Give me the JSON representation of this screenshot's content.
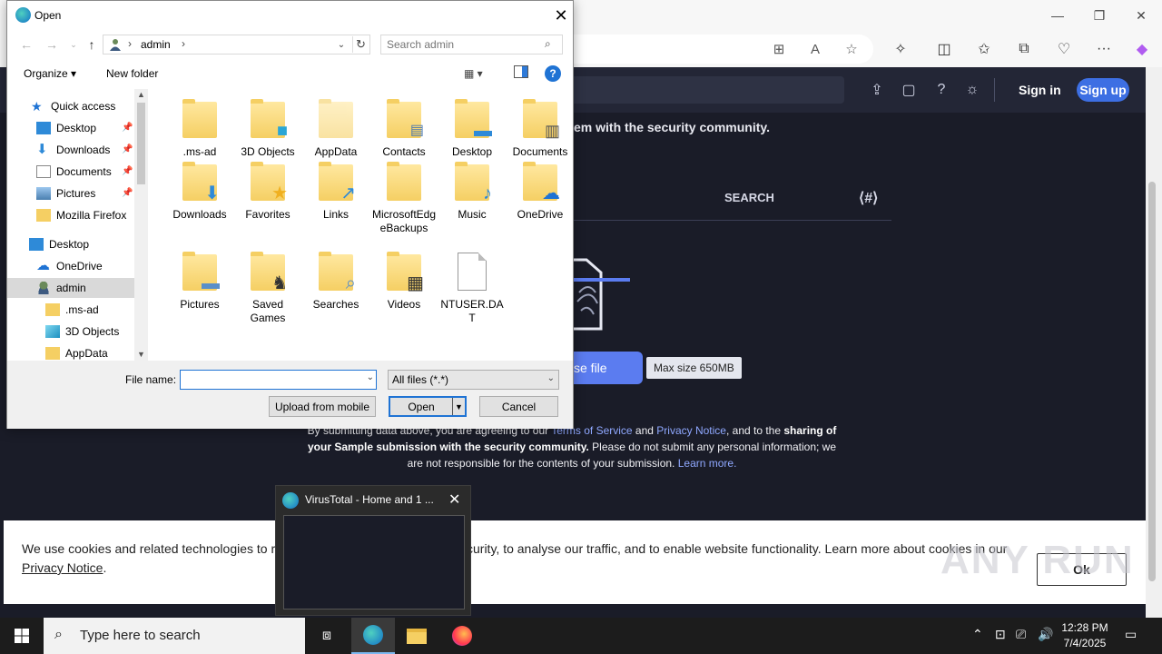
{
  "dialog": {
    "title": "Open",
    "path_label": "admin",
    "search_placeholder": "Search admin",
    "organize_label": "Organize ▾",
    "new_folder_label": "New folder",
    "help_label": "?",
    "file_name_label": "File name:",
    "file_name_value": "",
    "file_type_value": "All files (*.*)",
    "upload_mobile_label": "Upload from mobile",
    "open_label": "Open",
    "cancel_label": "Cancel"
  },
  "nav_pane": {
    "items": [
      {
        "label": "Quick access",
        "icon": "star-icon"
      },
      {
        "label": "Desktop",
        "icon": "desktop-icon",
        "pinned": true
      },
      {
        "label": "Downloads",
        "icon": "download-icon",
        "pinned": true
      },
      {
        "label": "Documents",
        "icon": "document-icon",
        "pinned": true
      },
      {
        "label": "Pictures",
        "icon": "picture-icon",
        "pinned": true
      },
      {
        "label": "Mozilla Firefox",
        "icon": "folder-icon"
      },
      {
        "label": "Desktop",
        "icon": "desktop-icon"
      },
      {
        "label": "OneDrive",
        "icon": "cloud-icon"
      },
      {
        "label": "admin",
        "icon": "user-icon",
        "selected": true
      },
      {
        "label": ".ms-ad",
        "icon": "folder-icon"
      },
      {
        "label": "3D Objects",
        "icon": "cube-icon"
      },
      {
        "label": "AppData",
        "icon": "folder-icon"
      }
    ]
  },
  "files": [
    {
      "label": ".ms-ad",
      "icon": "folder-icon"
    },
    {
      "label": "3D Objects",
      "icon": "cube-folder-icon"
    },
    {
      "label": "AppData",
      "icon": "folder-icon"
    },
    {
      "label": "Contacts",
      "icon": "contacts-folder-icon"
    },
    {
      "label": "Desktop",
      "icon": "desktop-folder-icon"
    },
    {
      "label": "Documents",
      "icon": "documents-folder-icon"
    },
    {
      "label": "Downloads",
      "icon": "downloads-folder-icon"
    },
    {
      "label": "Favorites",
      "icon": "favorites-folder-icon"
    },
    {
      "label": "Links",
      "icon": "links-folder-icon"
    },
    {
      "label": "MicrosoftEdgeBackups",
      "icon": "folder-icon"
    },
    {
      "label": "Music",
      "icon": "music-folder-icon"
    },
    {
      "label": "OneDrive",
      "icon": "onedrive-folder-icon"
    },
    {
      "label": "Pictures",
      "icon": "pictures-folder-icon"
    },
    {
      "label": "Saved Games",
      "icon": "saved-games-folder-icon"
    },
    {
      "label": "Searches",
      "icon": "searches-folder-icon"
    },
    {
      "label": "Videos",
      "icon": "videos-folder-icon"
    },
    {
      "label": "NTUSER.DAT",
      "icon": "file-icon"
    }
  ],
  "site": {
    "hero_text": "em with the security community.",
    "tab_search": "SEARCH",
    "choose_file": "se file",
    "max_size": "Max size 650MB",
    "sign_in": "Sign in",
    "sign_up": "Sign up",
    "terms": {
      "p1": "By submitting data above, you are agreeing to our ",
      "link1": "Terms of Service",
      "p2": " and ",
      "link2": "Privacy Notice",
      "p3": ", and to the ",
      "bold1": "sharing of your Sample submission with the security community.",
      "p4": " Please do not submit any personal information; we are not responsible for the contents of your submission. ",
      "link3": "Learn more."
    }
  },
  "cookie": {
    "text_before": "We use cookies and related technologies to remember user preferences, for security, to analyse our traffic, and to enable website functionality. Learn more about cookies in our ",
    "link": "Privacy Notice",
    "text_after": ".",
    "ok_label": "Ok"
  },
  "watermark": "ANY RUN",
  "thumbnail": {
    "title": "VirusTotal - Home and 1 ..."
  },
  "taskbar": {
    "search_placeholder": "Type here to search",
    "time": "12:28 PM",
    "date": "7/4/2025"
  },
  "colors": {
    "accent": "#1f73d4",
    "site_bg": "#1a1c28",
    "sign_up": "#3d6fe3",
    "choose_file": "#5b7cf0"
  }
}
